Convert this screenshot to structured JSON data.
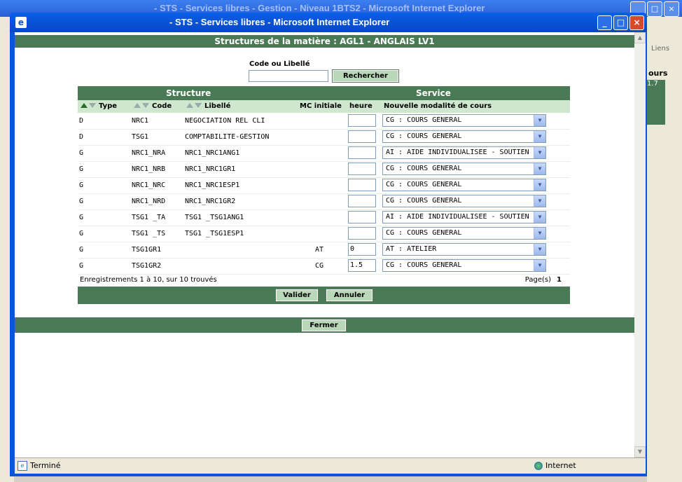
{
  "background_window": {
    "title": "- STS - Services libres - Gestion - Niveau 1BTS2 - Microsoft Internet Explorer",
    "links_label": "Liens",
    "cours_label": "ours",
    "green_text": "1.7"
  },
  "popup": {
    "title": "- STS - Services libres - Microsoft Internet Explorer",
    "header": "Structures de la matière : AGL1  - ANGLAIS LV1",
    "search": {
      "label": "Code ou Libellé",
      "value": "",
      "button": "Rechercher"
    },
    "table": {
      "group_structure": "Structure",
      "group_service": "Service",
      "columns": {
        "type": "Type",
        "code": "Code",
        "libelle": "Libellé",
        "mc": "MC initiale",
        "heure": "heure",
        "modalite": "Nouvelle modalité de cours"
      },
      "rows": [
        {
          "type": "D",
          "code": "NRC1",
          "libelle": "NEGOCIATION REL CLI",
          "mc": "",
          "heure": "",
          "modalite": "CG : COURS GENERAL"
        },
        {
          "type": "D",
          "code": "TSG1",
          "libelle": "COMPTABILITE-GESTION",
          "mc": "",
          "heure": "",
          "modalite": "CG : COURS GENERAL"
        },
        {
          "type": "G",
          "code": "NRC1_NRA",
          "libelle": "NRC1_NRC1ANG1",
          "mc": "",
          "heure": "",
          "modalite": "AI : AIDE INDIVIDUALISEE - SOUTIEN"
        },
        {
          "type": "G",
          "code": "NRC1_NRB",
          "libelle": "NRC1_NRC1GR1",
          "mc": "",
          "heure": "",
          "modalite": "CG : COURS GENERAL"
        },
        {
          "type": "G",
          "code": "NRC1_NRC",
          "libelle": "NRC1_NRC1ESP1",
          "mc": "",
          "heure": "",
          "modalite": "CG : COURS GENERAL"
        },
        {
          "type": "G",
          "code": "NRC1_NRD",
          "libelle": "NRC1_NRC1GR2",
          "mc": "",
          "heure": "",
          "modalite": "CG : COURS GENERAL"
        },
        {
          "type": "G",
          "code": "TSG1 _TA",
          "libelle": "TSG1 _TSG1ANG1",
          "mc": "",
          "heure": "",
          "modalite": "AI : AIDE INDIVIDUALISEE - SOUTIEN"
        },
        {
          "type": "G",
          "code": "TSG1 _TS",
          "libelle": "TSG1 _TSG1ESP1",
          "mc": "",
          "heure": "",
          "modalite": "CG : COURS GENERAL"
        },
        {
          "type": "G",
          "code": "TSG1GR1",
          "libelle": "",
          "mc": "AT",
          "heure": "0",
          "modalite": "AT : ATELIER"
        },
        {
          "type": "G",
          "code": "TSG1GR2",
          "libelle": "",
          "mc": "CG",
          "heure": "1.5",
          "modalite": "CG : COURS GENERAL"
        }
      ],
      "footer_left": "Enregistrements 1 à 10, sur 10 trouvés",
      "footer_pages_label": "Page(s)",
      "footer_page": "1"
    },
    "buttons": {
      "valider": "Valider",
      "annuler": "Annuler",
      "fermer": "Fermer"
    },
    "status": {
      "left": "Terminé",
      "right": "Internet"
    }
  },
  "colors": {
    "accent_green": "#4a7a55",
    "light_green": "#cfe6cf",
    "title_blue": "#0a56d8"
  }
}
